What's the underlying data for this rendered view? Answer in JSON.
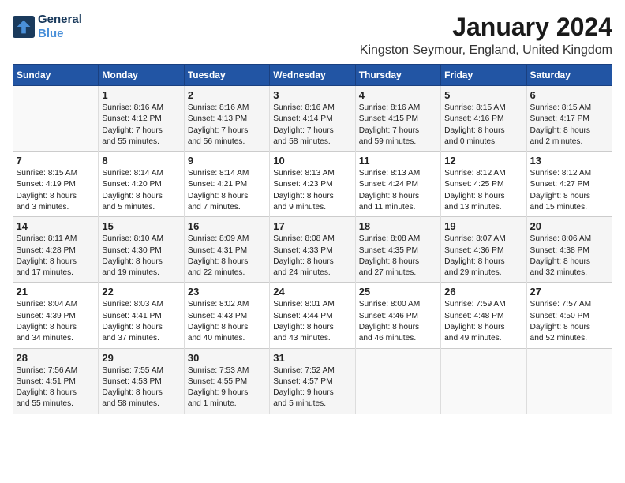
{
  "logo": {
    "line1": "General",
    "line2": "Blue"
  },
  "title": "January 2024",
  "subtitle": "Kingston Seymour, England, United Kingdom",
  "days_header": [
    "Sunday",
    "Monday",
    "Tuesday",
    "Wednesday",
    "Thursday",
    "Friday",
    "Saturday"
  ],
  "weeks": [
    [
      {
        "day": "",
        "content": ""
      },
      {
        "day": "1",
        "content": "Sunrise: 8:16 AM\nSunset: 4:12 PM\nDaylight: 7 hours\nand 55 minutes."
      },
      {
        "day": "2",
        "content": "Sunrise: 8:16 AM\nSunset: 4:13 PM\nDaylight: 7 hours\nand 56 minutes."
      },
      {
        "day": "3",
        "content": "Sunrise: 8:16 AM\nSunset: 4:14 PM\nDaylight: 7 hours\nand 58 minutes."
      },
      {
        "day": "4",
        "content": "Sunrise: 8:16 AM\nSunset: 4:15 PM\nDaylight: 7 hours\nand 59 minutes."
      },
      {
        "day": "5",
        "content": "Sunrise: 8:15 AM\nSunset: 4:16 PM\nDaylight: 8 hours\nand 0 minutes."
      },
      {
        "day": "6",
        "content": "Sunrise: 8:15 AM\nSunset: 4:17 PM\nDaylight: 8 hours\nand 2 minutes."
      }
    ],
    [
      {
        "day": "7",
        "content": "Sunrise: 8:15 AM\nSunset: 4:19 PM\nDaylight: 8 hours\nand 3 minutes."
      },
      {
        "day": "8",
        "content": "Sunrise: 8:14 AM\nSunset: 4:20 PM\nDaylight: 8 hours\nand 5 minutes."
      },
      {
        "day": "9",
        "content": "Sunrise: 8:14 AM\nSunset: 4:21 PM\nDaylight: 8 hours\nand 7 minutes."
      },
      {
        "day": "10",
        "content": "Sunrise: 8:13 AM\nSunset: 4:23 PM\nDaylight: 8 hours\nand 9 minutes."
      },
      {
        "day": "11",
        "content": "Sunrise: 8:13 AM\nSunset: 4:24 PM\nDaylight: 8 hours\nand 11 minutes."
      },
      {
        "day": "12",
        "content": "Sunrise: 8:12 AM\nSunset: 4:25 PM\nDaylight: 8 hours\nand 13 minutes."
      },
      {
        "day": "13",
        "content": "Sunrise: 8:12 AM\nSunset: 4:27 PM\nDaylight: 8 hours\nand 15 minutes."
      }
    ],
    [
      {
        "day": "14",
        "content": "Sunrise: 8:11 AM\nSunset: 4:28 PM\nDaylight: 8 hours\nand 17 minutes."
      },
      {
        "day": "15",
        "content": "Sunrise: 8:10 AM\nSunset: 4:30 PM\nDaylight: 8 hours\nand 19 minutes."
      },
      {
        "day": "16",
        "content": "Sunrise: 8:09 AM\nSunset: 4:31 PM\nDaylight: 8 hours\nand 22 minutes."
      },
      {
        "day": "17",
        "content": "Sunrise: 8:08 AM\nSunset: 4:33 PM\nDaylight: 8 hours\nand 24 minutes."
      },
      {
        "day": "18",
        "content": "Sunrise: 8:08 AM\nSunset: 4:35 PM\nDaylight: 8 hours\nand 27 minutes."
      },
      {
        "day": "19",
        "content": "Sunrise: 8:07 AM\nSunset: 4:36 PM\nDaylight: 8 hours\nand 29 minutes."
      },
      {
        "day": "20",
        "content": "Sunrise: 8:06 AM\nSunset: 4:38 PM\nDaylight: 8 hours\nand 32 minutes."
      }
    ],
    [
      {
        "day": "21",
        "content": "Sunrise: 8:04 AM\nSunset: 4:39 PM\nDaylight: 8 hours\nand 34 minutes."
      },
      {
        "day": "22",
        "content": "Sunrise: 8:03 AM\nSunset: 4:41 PM\nDaylight: 8 hours\nand 37 minutes."
      },
      {
        "day": "23",
        "content": "Sunrise: 8:02 AM\nSunset: 4:43 PM\nDaylight: 8 hours\nand 40 minutes."
      },
      {
        "day": "24",
        "content": "Sunrise: 8:01 AM\nSunset: 4:44 PM\nDaylight: 8 hours\nand 43 minutes."
      },
      {
        "day": "25",
        "content": "Sunrise: 8:00 AM\nSunset: 4:46 PM\nDaylight: 8 hours\nand 46 minutes."
      },
      {
        "day": "26",
        "content": "Sunrise: 7:59 AM\nSunset: 4:48 PM\nDaylight: 8 hours\nand 49 minutes."
      },
      {
        "day": "27",
        "content": "Sunrise: 7:57 AM\nSunset: 4:50 PM\nDaylight: 8 hours\nand 52 minutes."
      }
    ],
    [
      {
        "day": "28",
        "content": "Sunrise: 7:56 AM\nSunset: 4:51 PM\nDaylight: 8 hours\nand 55 minutes."
      },
      {
        "day": "29",
        "content": "Sunrise: 7:55 AM\nSunset: 4:53 PM\nDaylight: 8 hours\nand 58 minutes."
      },
      {
        "day": "30",
        "content": "Sunrise: 7:53 AM\nSunset: 4:55 PM\nDaylight: 9 hours\nand 1 minute."
      },
      {
        "day": "31",
        "content": "Sunrise: 7:52 AM\nSunset: 4:57 PM\nDaylight: 9 hours\nand 5 minutes."
      },
      {
        "day": "",
        "content": ""
      },
      {
        "day": "",
        "content": ""
      },
      {
        "day": "",
        "content": ""
      }
    ]
  ]
}
